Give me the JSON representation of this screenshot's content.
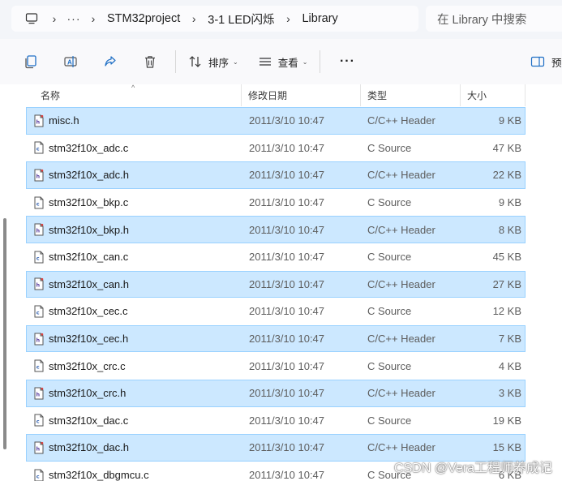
{
  "breadcrumb": {
    "overflow": "···",
    "items": [
      "STM32project",
      "3-1 LED闪烁",
      "Library"
    ]
  },
  "search": {
    "placeholder": "在 Library 中搜索"
  },
  "toolbar": {
    "sort_label": "排序",
    "view_label": "查看",
    "more_label": "···",
    "preview_label": "预"
  },
  "columns": {
    "name": "名称",
    "date": "修改日期",
    "type": "类型",
    "size": "大小"
  },
  "files": [
    {
      "name": "misc.h",
      "date": "2011/3/10 10:47",
      "type": "C/C++ Header",
      "size": "9 KB",
      "kind": "h",
      "selected": true
    },
    {
      "name": "stm32f10x_adc.c",
      "date": "2011/3/10 10:47",
      "type": "C Source",
      "size": "47 KB",
      "kind": "c",
      "selected": false
    },
    {
      "name": "stm32f10x_adc.h",
      "date": "2011/3/10 10:47",
      "type": "C/C++ Header",
      "size": "22 KB",
      "kind": "h",
      "selected": true
    },
    {
      "name": "stm32f10x_bkp.c",
      "date": "2011/3/10 10:47",
      "type": "C Source",
      "size": "9 KB",
      "kind": "c",
      "selected": false
    },
    {
      "name": "stm32f10x_bkp.h",
      "date": "2011/3/10 10:47",
      "type": "C/C++ Header",
      "size": "8 KB",
      "kind": "h",
      "selected": true
    },
    {
      "name": "stm32f10x_can.c",
      "date": "2011/3/10 10:47",
      "type": "C Source",
      "size": "45 KB",
      "kind": "c",
      "selected": false
    },
    {
      "name": "stm32f10x_can.h",
      "date": "2011/3/10 10:47",
      "type": "C/C++ Header",
      "size": "27 KB",
      "kind": "h",
      "selected": true
    },
    {
      "name": "stm32f10x_cec.c",
      "date": "2011/3/10 10:47",
      "type": "C Source",
      "size": "12 KB",
      "kind": "c",
      "selected": false
    },
    {
      "name": "stm32f10x_cec.h",
      "date": "2011/3/10 10:47",
      "type": "C/C++ Header",
      "size": "7 KB",
      "kind": "h",
      "selected": true
    },
    {
      "name": "stm32f10x_crc.c",
      "date": "2011/3/10 10:47",
      "type": "C Source",
      "size": "4 KB",
      "kind": "c",
      "selected": false
    },
    {
      "name": "stm32f10x_crc.h",
      "date": "2011/3/10 10:47",
      "type": "C/C++ Header",
      "size": "3 KB",
      "kind": "h",
      "selected": true
    },
    {
      "name": "stm32f10x_dac.c",
      "date": "2011/3/10 10:47",
      "type": "C Source",
      "size": "19 KB",
      "kind": "c",
      "selected": false
    },
    {
      "name": "stm32f10x_dac.h",
      "date": "2011/3/10 10:47",
      "type": "C/C++ Header",
      "size": "15 KB",
      "kind": "h",
      "selected": true
    },
    {
      "name": "stm32f10x_dbgmcu.c",
      "date": "2011/3/10 10:47",
      "type": "C Source",
      "size": "6 KB",
      "kind": "c",
      "selected": false
    }
  ],
  "watermark": "CSDN @Vera工程师养成记",
  "colors": {
    "selection": "#cce8ff",
    "selection_border": "#99d1ff",
    "accent": "#0067c0"
  },
  "icons": {
    "computer": "computer-icon",
    "copy": "copy-icon",
    "rename": "rename-icon",
    "share": "share-icon",
    "delete": "delete-icon",
    "sort": "sort-icon",
    "view": "view-icon",
    "preview": "preview-pane-icon"
  }
}
